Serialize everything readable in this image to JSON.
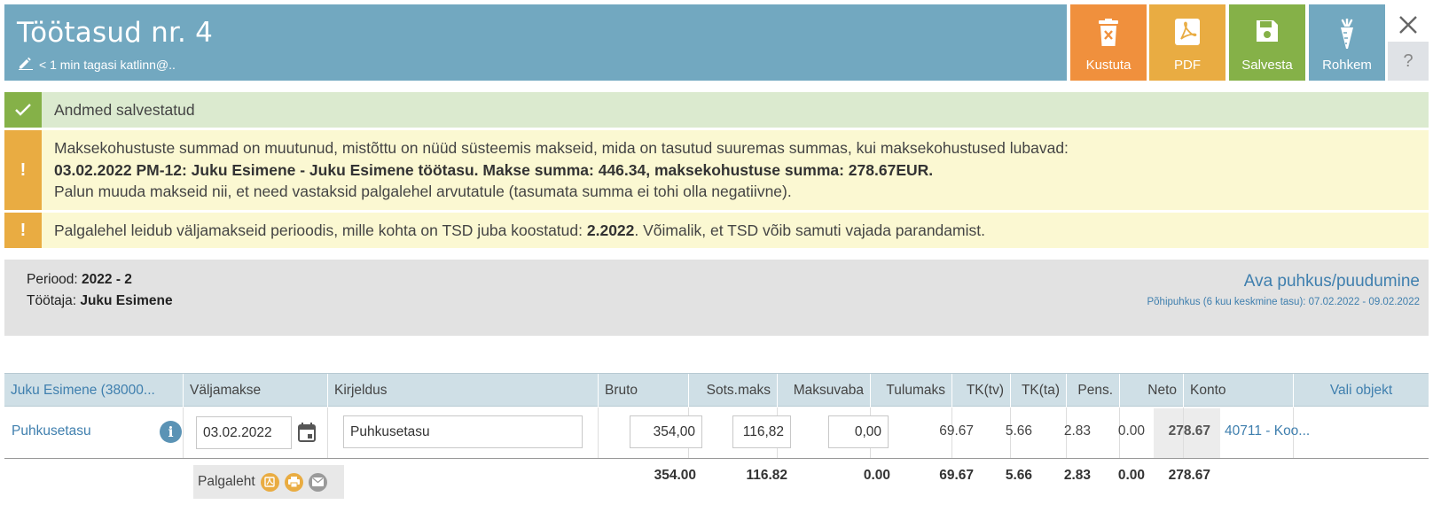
{
  "header": {
    "title": "Töötasud nr. 4",
    "subtitle": "< 1 min tagasi katlinn@..",
    "edit_icon": "pencil-icon"
  },
  "actions": {
    "delete_label": "Kustuta",
    "pdf_label": "PDF",
    "save_label": "Salvesta",
    "more_label": "Rohkem",
    "help_label": "?",
    "colors": {
      "delete": "#f0903d",
      "pdf": "#e9ac42",
      "save": "#85b148",
      "more": "#72a8c0"
    }
  },
  "messages": {
    "success": {
      "icon": "check-icon",
      "text": "Andmed salvestatud"
    },
    "warning1": {
      "icon_text": "!",
      "line1": "Maksekohustuste summad on muutunud, mistõttu on nüüd süsteemis makseid, mida on tasutud suuremas summas, kui maksekohustused lubavad:",
      "line2": "03.02.2022 PM-12: Juku Esimene - Juku Esimene töötasu. Makse summa: 446.34, maksekohustuse summa: 278.67EUR.",
      "line3": "Palun muuda makseid nii, et need vastaksid palgalehel arvutatule (tasumata summa ei tohi olla negatiivne)."
    },
    "warning2": {
      "icon_text": "!",
      "before": "Palgalehel leidub väljamakseid perioodis, mille kohta on TSD juba koostatud: ",
      "bold": "2.2022",
      "after": ". Võimalik, et TSD võib samuti vajada parandamist."
    }
  },
  "info": {
    "period_label": "Periood:",
    "period_value": "2022 - 2",
    "employee_label": "Töötaja:",
    "employee_value": "Juku Esimene",
    "leave_link": "Ava puhkus/puudumine",
    "leave_detail": "Põhipuhkus (6 kuu keskmine tasu): 07.02.2022 - 09.02.2022"
  },
  "table": {
    "headers": {
      "employee": "Juku Esimene (38000...",
      "payout": "Väljamakse",
      "description": "Kirjeldus",
      "gross": "Bruto",
      "social": "Sots.maks",
      "taxfree": "Maksuvaba",
      "income_tax": "Tulumaks",
      "tk_tv": "TK(tv)",
      "tk_ta": "TK(ta)",
      "pension": "Pens.",
      "net": "Neto",
      "account": "Konto",
      "object": "Vali objekt"
    },
    "row": {
      "type": "Puhkusetasu",
      "date": "03.02.2022",
      "description": "Puhkusetasu",
      "gross": "354,00",
      "social": "116,82",
      "taxfree": "0,00",
      "income_tax": "69.67",
      "tk_tv": "5.66",
      "tk_ta": "2.83",
      "pension": "0.00",
      "net": "278.67",
      "account": "40711 - Koo..."
    },
    "totals": {
      "gross": "354.00",
      "social": "116.82",
      "taxfree": "0.00",
      "income_tax": "69.67",
      "tk_tv": "5.66",
      "tk_ta": "2.83",
      "pension": "0.00",
      "net": "278.67"
    },
    "payslip_label": "Palgaleht"
  }
}
